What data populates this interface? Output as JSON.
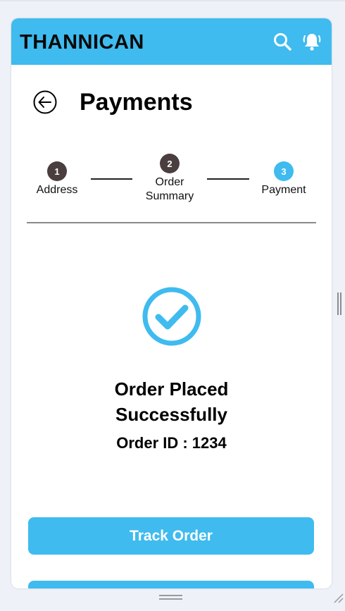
{
  "app": {
    "title": "THANNICAN",
    "icons": [
      "search-icon",
      "bell-icon"
    ]
  },
  "page": {
    "title": "Payments"
  },
  "steps": [
    {
      "number": "1",
      "label": "Address"
    },
    {
      "number": "2",
      "label": "Order Summary"
    },
    {
      "number": "3",
      "label": "Payment"
    }
  ],
  "confirmation": {
    "line1": "Order Placed",
    "line2": "Successfully",
    "order_id": "Order ID : 1234"
  },
  "buttons": {
    "track_order": "Track Order"
  },
  "colors": {
    "accent": "#3fbbef",
    "step_done": "#4b3e3e",
    "text": "#000000"
  }
}
